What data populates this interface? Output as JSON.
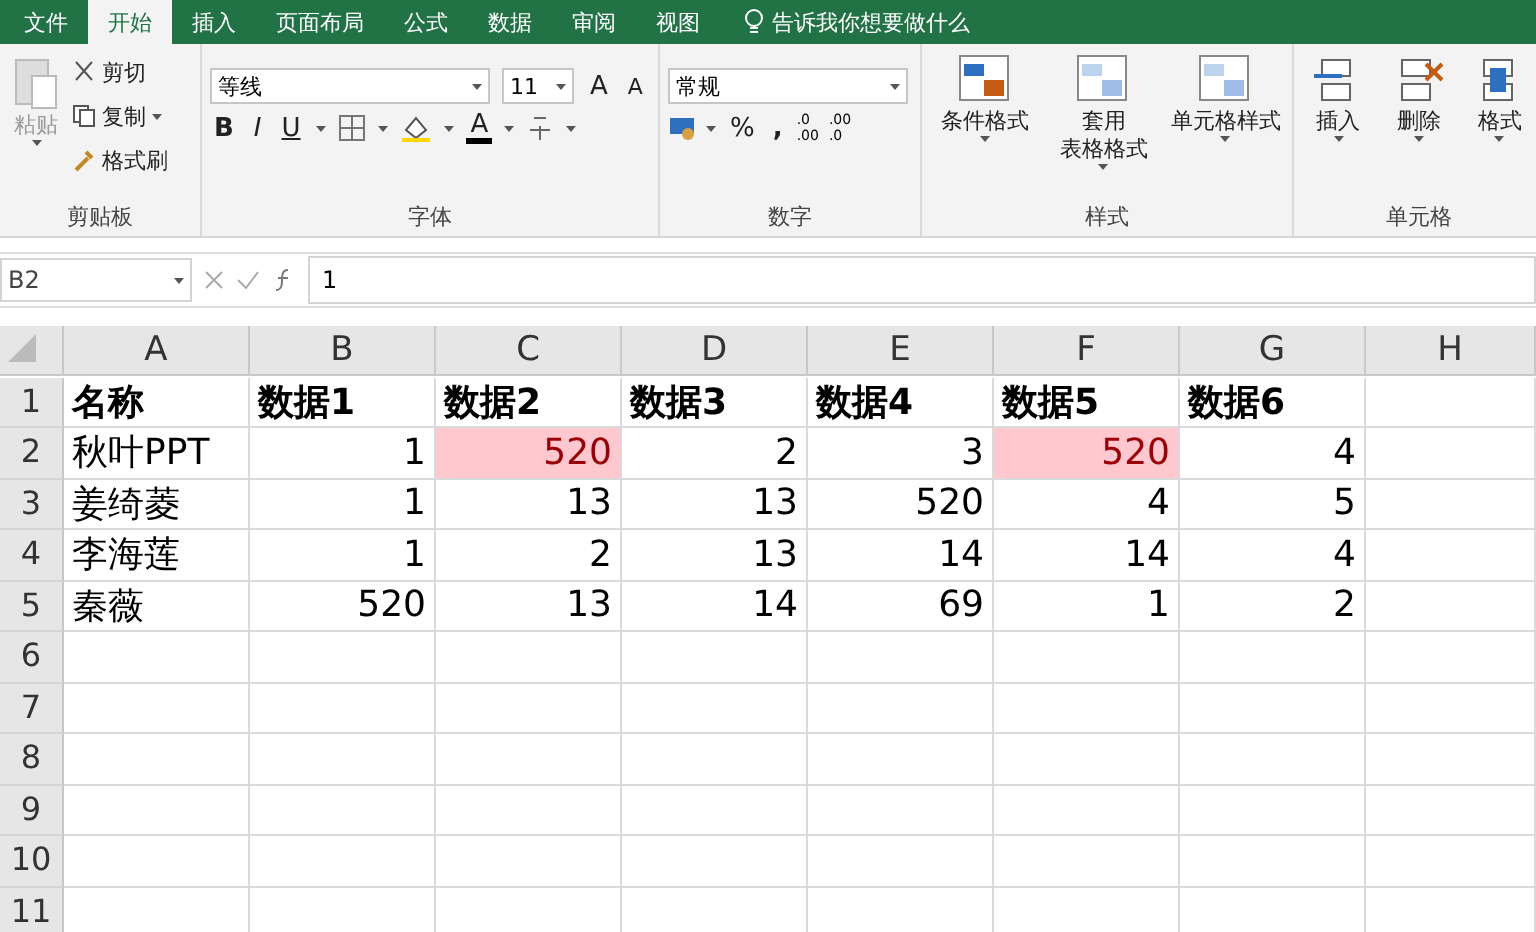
{
  "menu_tabs": [
    {
      "label": "文件",
      "selected": false
    },
    {
      "label": "开始",
      "selected": true
    },
    {
      "label": "插入",
      "selected": false
    },
    {
      "label": "页面布局",
      "selected": false
    },
    {
      "label": "公式",
      "selected": false
    },
    {
      "label": "数据",
      "selected": false
    },
    {
      "label": "审阅",
      "selected": false
    },
    {
      "label": "视图",
      "selected": false
    }
  ],
  "tell_me": "告诉我你想要做什么",
  "clipboard": {
    "paste": "粘贴",
    "cut": "剪切",
    "copy": "复制",
    "format_painter": "格式刷",
    "label": "剪贴板"
  },
  "font": {
    "name": "等线",
    "size": "11",
    "grow": "A",
    "shrink": "A",
    "bold": "B",
    "italic": "I",
    "underline": "U",
    "font_color": "A",
    "label": "字体"
  },
  "number": {
    "format": "常规",
    "percent": "%",
    "comma": ",",
    "increase_decimal": [
      ".0",
      ".00"
    ],
    "decrease_decimal": [
      ".00",
      ".0"
    ],
    "label": "数字"
  },
  "styles": {
    "items": [
      {
        "lines": [
          "条件格式"
        ]
      },
      {
        "lines": [
          "套用",
          "表格格式"
        ]
      },
      {
        "lines": [
          "单元格样式"
        ]
      }
    ],
    "label": "样式"
  },
  "cells_group": {
    "items": [
      {
        "label": "插入"
      },
      {
        "label": "删除"
      },
      {
        "label": "格式"
      }
    ],
    "label": "单元格"
  },
  "formula_bar": {
    "name_box": "B2",
    "value": "1"
  },
  "columns": [
    "A",
    "B",
    "C",
    "D",
    "E",
    "F",
    "G",
    "H"
  ],
  "rows": [
    {
      "number": "1",
      "header": true,
      "cells": [
        {
          "text": "名称",
          "kind": "text",
          "highlighted": false
        },
        {
          "text": "数据1",
          "kind": "text",
          "highlighted": false
        },
        {
          "text": "数据2",
          "kind": "text",
          "highlighted": false
        },
        {
          "text": "数据3",
          "kind": "text",
          "highlighted": false
        },
        {
          "text": "数据4",
          "kind": "text",
          "highlighted": false
        },
        {
          "text": "数据5",
          "kind": "text",
          "highlighted": false
        },
        {
          "text": "数据6",
          "kind": "text",
          "highlighted": false
        }
      ]
    },
    {
      "number": "2",
      "header": false,
      "cells": [
        {
          "text": "秋叶PPT",
          "kind": "text",
          "highlighted": false
        },
        {
          "text": "1",
          "kind": "number",
          "highlighted": false
        },
        {
          "text": "520",
          "kind": "number",
          "highlighted": true
        },
        {
          "text": "2",
          "kind": "number",
          "highlighted": false
        },
        {
          "text": "3",
          "kind": "number",
          "highlighted": false
        },
        {
          "text": "520",
          "kind": "number",
          "highlighted": true
        },
        {
          "text": "4",
          "kind": "number",
          "highlighted": false
        }
      ]
    },
    {
      "number": "3",
      "header": false,
      "cells": [
        {
          "text": "姜绮菱",
          "kind": "text",
          "highlighted": false
        },
        {
          "text": "1",
          "kind": "number",
          "highlighted": false
        },
        {
          "text": "13",
          "kind": "number",
          "highlighted": false
        },
        {
          "text": "13",
          "kind": "number",
          "highlighted": false
        },
        {
          "text": "520",
          "kind": "number",
          "highlighted": false
        },
        {
          "text": "4",
          "kind": "number",
          "highlighted": false
        },
        {
          "text": "5",
          "kind": "number",
          "highlighted": false
        }
      ]
    },
    {
      "number": "4",
      "header": false,
      "cells": [
        {
          "text": "李海莲",
          "kind": "text",
          "highlighted": false
        },
        {
          "text": "1",
          "kind": "number",
          "highlighted": false
        },
        {
          "text": "2",
          "kind": "number",
          "highlighted": false
        },
        {
          "text": "13",
          "kind": "number",
          "highlighted": false
        },
        {
          "text": "14",
          "kind": "number",
          "highlighted": false
        },
        {
          "text": "14",
          "kind": "number",
          "highlighted": false
        },
        {
          "text": "4",
          "kind": "number",
          "highlighted": false
        }
      ]
    },
    {
      "number": "5",
      "header": false,
      "cells": [
        {
          "text": "秦薇",
          "kind": "text",
          "highlighted": false
        },
        {
          "text": "520",
          "kind": "number",
          "highlighted": false
        },
        {
          "text": "13",
          "kind": "number",
          "highlighted": false
        },
        {
          "text": "14",
          "kind": "number",
          "highlighted": false
        },
        {
          "text": "69",
          "kind": "number",
          "highlighted": false
        },
        {
          "text": "1",
          "kind": "number",
          "highlighted": false
        },
        {
          "text": "2",
          "kind": "number",
          "highlighted": false
        }
      ]
    },
    {
      "number": "6"
    },
    {
      "number": "7"
    },
    {
      "number": "8"
    },
    {
      "number": "9"
    },
    {
      "number": "10"
    },
    {
      "number": "11"
    }
  ]
}
